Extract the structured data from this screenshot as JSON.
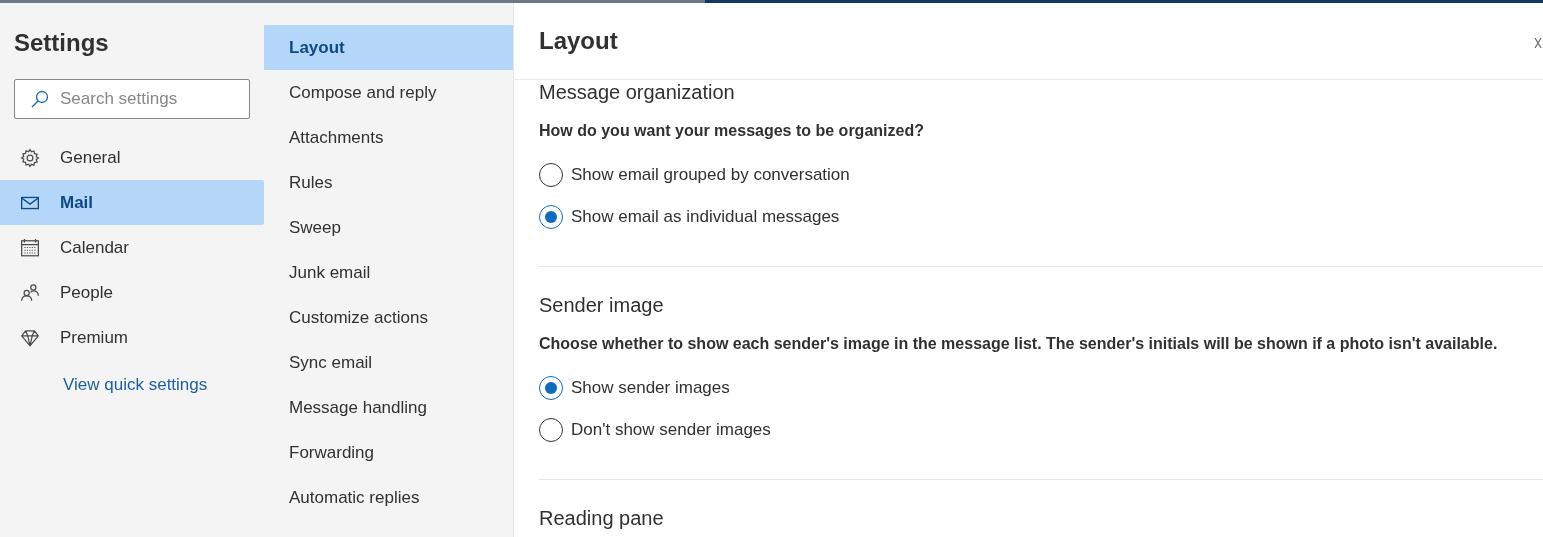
{
  "sidebar": {
    "title": "Settings",
    "search": {
      "placeholder": "Search settings"
    },
    "items": [
      {
        "label": "General",
        "selected": false
      },
      {
        "label": "Mail",
        "selected": true
      },
      {
        "label": "Calendar",
        "selected": false
      },
      {
        "label": "People",
        "selected": false
      },
      {
        "label": "Premium",
        "selected": false
      }
    ],
    "link": "View quick settings"
  },
  "subnav": {
    "items": [
      {
        "label": "Layout",
        "selected": true
      },
      {
        "label": "Compose and reply",
        "selected": false
      },
      {
        "label": "Attachments",
        "selected": false
      },
      {
        "label": "Rules",
        "selected": false
      },
      {
        "label": "Sweep",
        "selected": false
      },
      {
        "label": "Junk email",
        "selected": false
      },
      {
        "label": "Customize actions",
        "selected": false
      },
      {
        "label": "Sync email",
        "selected": false
      },
      {
        "label": "Message handling",
        "selected": false
      },
      {
        "label": "Forwarding",
        "selected": false
      },
      {
        "label": "Automatic replies",
        "selected": false
      }
    ]
  },
  "main": {
    "title": "Layout",
    "sections": [
      {
        "heading": "Message organization",
        "question": "How do you want your messages to be organized?",
        "options": [
          {
            "label": "Show email grouped by conversation",
            "selected": false
          },
          {
            "label": "Show email as individual messages",
            "selected": true
          }
        ]
      },
      {
        "heading": "Sender image",
        "question": "Choose whether to show each sender's image in the message list. The sender's initials will be shown if a photo isn't available.",
        "options": [
          {
            "label": "Show sender images",
            "selected": true
          },
          {
            "label": "Don't show sender images",
            "selected": false
          }
        ]
      },
      {
        "heading": "Reading pane"
      }
    ]
  }
}
